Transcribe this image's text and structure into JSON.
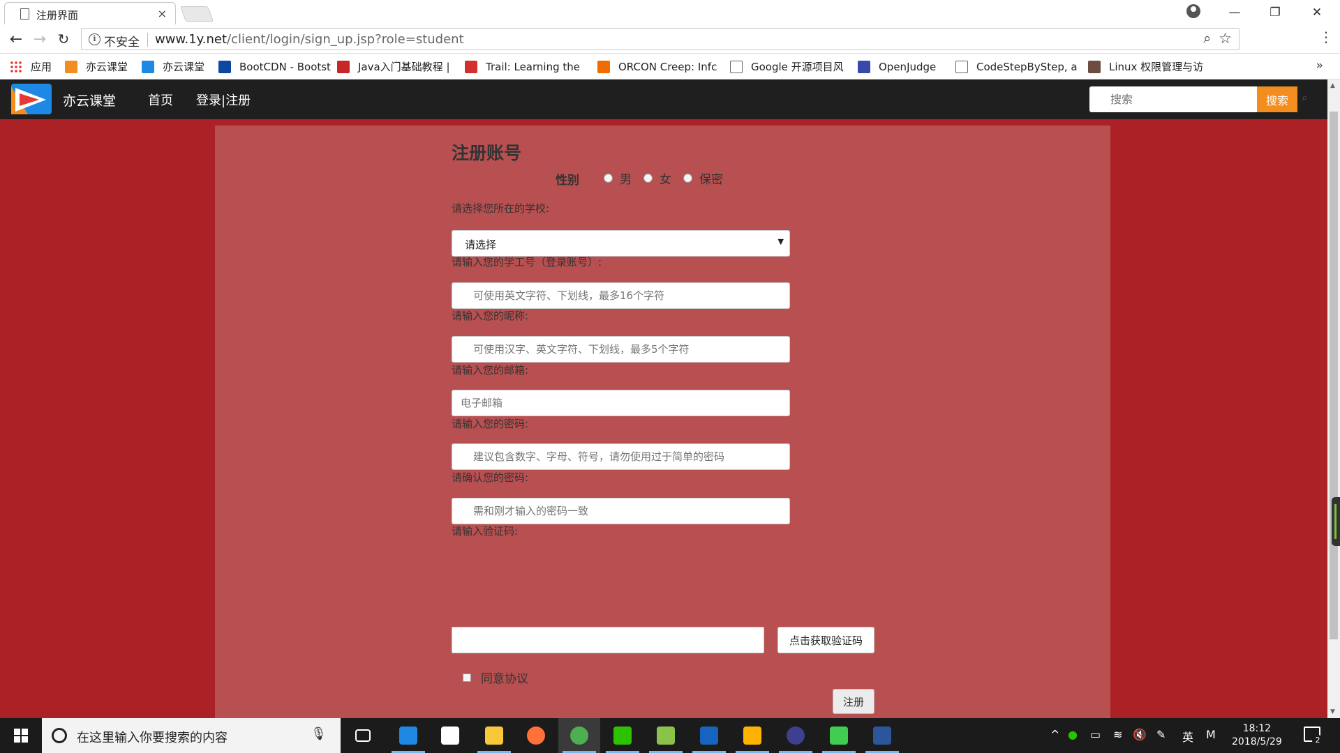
{
  "browser": {
    "tab_title": "注册界面",
    "tab_close": "×",
    "insecure_label": "不安全",
    "url_host": "www.1y.net",
    "url_path": "/client/login/sign_up.jsp?role=student",
    "bookmarks": [
      {
        "label": "应用",
        "icon": "apps-grid-icon",
        "color": "#e53935"
      },
      {
        "label": "亦云课堂",
        "icon": "yiyun-logo-icon",
        "color": "#f38d1d"
      },
      {
        "label": "亦云课堂",
        "icon": "yiyun-logo-icon",
        "color": "#1e88e5"
      },
      {
        "label": "BootCDN - Bootstr",
        "icon": "bootcdn-icon",
        "color": "#0d47a1"
      },
      {
        "label": "Java入门基础教程 |",
        "icon": "java-icon",
        "color": "#c62828"
      },
      {
        "label": "Trail: Learning the",
        "icon": "oracle-icon",
        "color": "#d32f2f"
      },
      {
        "label": "ORCON Creep: Infc",
        "icon": "orcon-icon",
        "color": "#ef6c00"
      },
      {
        "label": "Google 开源项目风",
        "icon": "page-icon",
        "color": "#ffffff"
      },
      {
        "label": "OpenJudge",
        "icon": "poj-icon",
        "color": "#3949ab"
      },
      {
        "label": "CodeStepByStep, a",
        "icon": "page-icon",
        "color": "#ffffff"
      },
      {
        "label": "Linux 权限管理与访",
        "icon": "linux-icon",
        "color": "#6d4c41"
      }
    ],
    "more": "»"
  },
  "site": {
    "brand": "亦云课堂",
    "nav": [
      "首页",
      "登录|注册"
    ],
    "search_placeholder": "搜索",
    "search_button": "搜索",
    "brand_colors": {
      "orange": "#f38d1d",
      "blue": "#1e88e5",
      "red": "#ab2125"
    }
  },
  "form": {
    "title": "注册账号",
    "gender_label": "性别",
    "gender_options": [
      "男",
      "女",
      "保密"
    ],
    "school_label": "请选择您所在的学校:",
    "school_value": "请选择",
    "student_id_label": "请输入您的学工号（登录账号）:",
    "student_id_placeholder": "可使用英文字符、下划线，最多16个字符",
    "nickname_label": "请输入您的昵称:",
    "nickname_placeholder": "可使用汉字、英文字符、下划线，最多5个字符",
    "email_label": "请输入您的邮箱:",
    "email_placeholder": "电子邮箱",
    "password_label": "请输入您的密码:",
    "password_placeholder": "建议包含数字、字母、符号，请勿使用过于简单的密码",
    "confirm_label": "请确认您的密码:",
    "confirm_placeholder": "需和刚才输入的密码一致",
    "captcha_label": "请输入验证码:",
    "captcha_button": "点击获取验证码",
    "agree_label": "同意协议",
    "submit_label": "注册"
  },
  "taskbar": {
    "search_placeholder": "在这里输入你要搜索的内容",
    "apps": [
      {
        "name": "task-view-icon",
        "color": "#ffffff"
      },
      {
        "name": "edge-icon",
        "color": "#1e88e5"
      },
      {
        "name": "sticky-notes-icon",
        "color": "#ffffff"
      },
      {
        "name": "file-explorer-icon",
        "color": "#f9c83a"
      },
      {
        "name": "firefox-icon",
        "color": "#ff7139"
      },
      {
        "name": "chrome-icon",
        "color": "#4caf50"
      },
      {
        "name": "wechat-icon",
        "color": "#2dc100"
      },
      {
        "name": "notepad-icon",
        "color": "#8bc34a"
      },
      {
        "name": "devcpp-icon",
        "color": "#1565c0"
      },
      {
        "name": "app-icon",
        "color": "#ffb300"
      },
      {
        "name": "eclipse-icon",
        "color": "#3f3f8f"
      },
      {
        "name": "qt-icon",
        "color": "#41cd52"
      },
      {
        "name": "word-icon",
        "color": "#2b579a"
      }
    ],
    "ime": "英",
    "ime2": "M",
    "time": "18:12",
    "date": "2018/5/29",
    "notification_count": "2"
  }
}
